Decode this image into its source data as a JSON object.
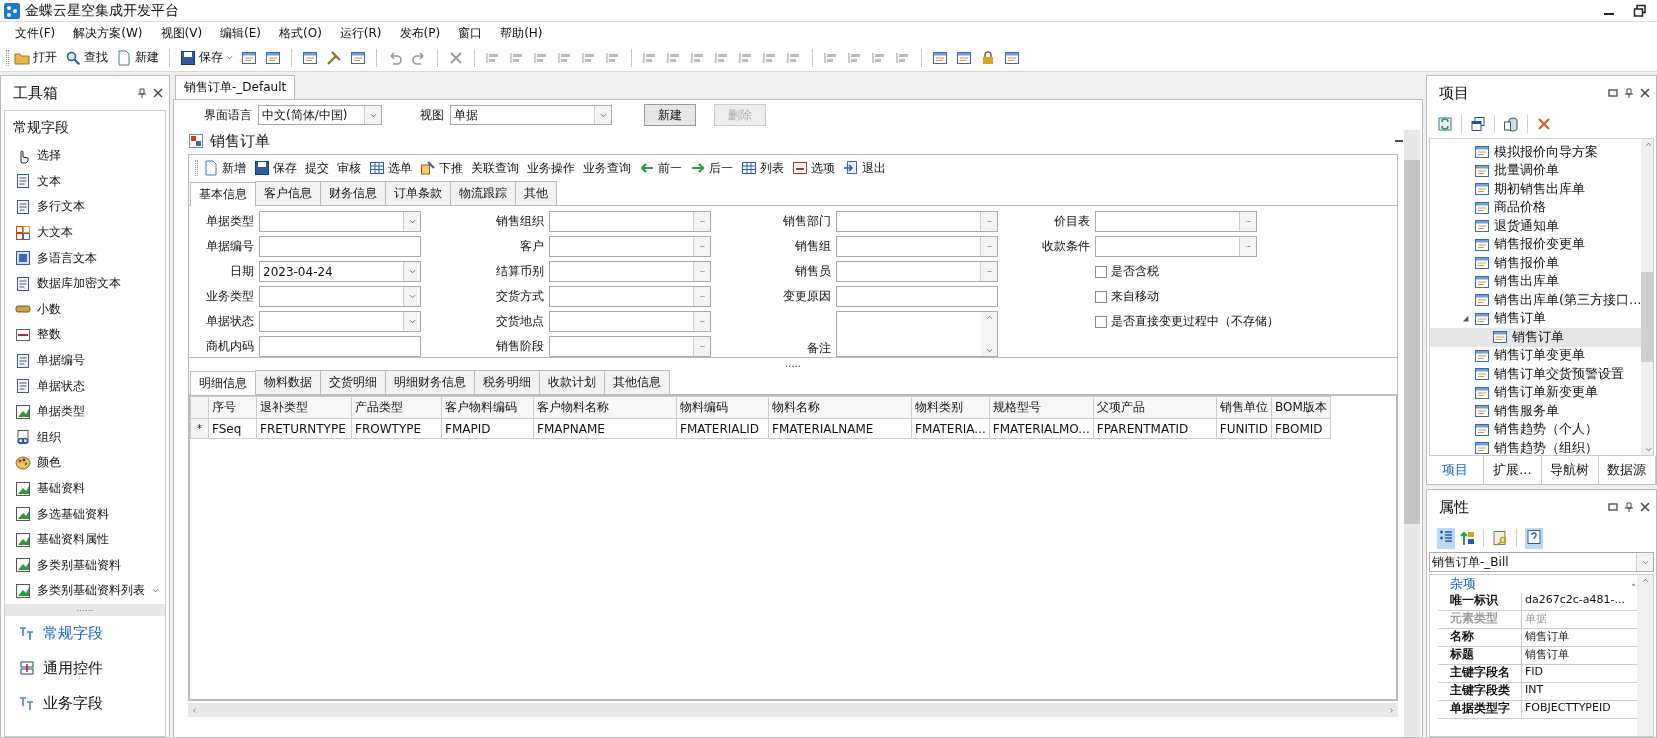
{
  "window": {
    "title": "金蝶云星空集成开发平台"
  },
  "menu": [
    "文件(F)",
    "解决方案(W)",
    "视图(V)",
    "编辑(E)",
    "格式(O)",
    "运行(R)",
    "发布(P)",
    "窗口",
    "帮助(H)"
  ],
  "toolbar": [
    {
      "kind": "button",
      "label": "打开"
    },
    {
      "kind": "button",
      "label": "查找"
    },
    {
      "kind": "button",
      "label": "新建"
    },
    {
      "kind": "separator"
    },
    {
      "kind": "dropdown",
      "label": "保存"
    },
    {
      "kind": "icon"
    },
    {
      "kind": "icon"
    },
    {
      "kind": "separator"
    },
    {
      "kind": "icon"
    },
    {
      "kind": "icon"
    },
    {
      "kind": "icon"
    },
    {
      "kind": "separator"
    },
    {
      "kind": "icon"
    },
    {
      "kind": "icon"
    },
    {
      "kind": "separator"
    },
    {
      "kind": "icon"
    },
    {
      "kind": "separator"
    },
    {
      "kind": "icon"
    },
    {
      "kind": "icon"
    },
    {
      "kind": "icon"
    },
    {
      "kind": "icon"
    },
    {
      "kind": "icon"
    },
    {
      "kind": "icon"
    },
    {
      "kind": "separator"
    },
    {
      "kind": "icon"
    },
    {
      "kind": "icon"
    },
    {
      "kind": "icon"
    },
    {
      "kind": "icon"
    },
    {
      "kind": "icon"
    },
    {
      "kind": "icon"
    },
    {
      "kind": "icon"
    },
    {
      "kind": "separator"
    },
    {
      "kind": "icon"
    },
    {
      "kind": "icon"
    },
    {
      "kind": "icon"
    },
    {
      "kind": "icon"
    },
    {
      "kind": "separator"
    },
    {
      "kind": "icon"
    },
    {
      "kind": "icon"
    },
    {
      "kind": "icon"
    },
    {
      "kind": "icon"
    }
  ],
  "toolbox": {
    "title": "工具箱",
    "category": "常规字段",
    "items": [
      "选择",
      "文本",
      "多行文本",
      "大文本",
      "多语言文本",
      "数据库加密文本",
      "小数",
      "整数",
      "单据编号",
      "单据状态",
      "单据类型",
      "组织",
      "颜色",
      "基础资料",
      "多选基础资料",
      "基础资料属性",
      "多类别基础资料",
      "多类别基础资料列表"
    ],
    "splitter": "......",
    "groups": [
      {
        "label": "常规字段",
        "selected": true
      },
      {
        "label": "通用控件",
        "selected": false
      },
      {
        "label": "业务字段",
        "selected": false
      }
    ]
  },
  "document": {
    "tab": "销售订单-_Default",
    "language": {
      "label": "界面语言",
      "value": "中文(简体/中国)"
    },
    "view": {
      "label": "视图",
      "value": "单据"
    },
    "buttons": [
      {
        "label": "新建",
        "disabled": false
      },
      {
        "label": "删除",
        "disabled": true
      }
    ],
    "form": {
      "title": "销售订单",
      "toolbar": [
        "新增",
        "保存",
        "提交",
        "审核",
        "选单",
        "下推",
        "关联查询",
        "业务操作",
        "业务查询",
        "前一",
        "后一",
        "列表",
        "选项",
        "退出"
      ],
      "tabs": [
        {
          "label": "基本信息",
          "selected": true
        },
        {
          "label": "客户信息",
          "selected": false
        },
        {
          "label": "财务信息",
          "selected": false
        },
        {
          "label": "订单条款",
          "selected": false
        },
        {
          "label": "物流跟踪",
          "selected": false
        },
        {
          "label": "其他",
          "selected": false
        }
      ],
      "columns": [
        [
          {
            "kind": "combo",
            "label": "单据类型"
          },
          {
            "kind": "text",
            "label": "单据编号"
          },
          {
            "kind": "combo",
            "label": "日期",
            "value": "2023-04-24"
          },
          {
            "kind": "combo",
            "label": "业务类型"
          },
          {
            "kind": "combo",
            "label": "单据状态"
          },
          {
            "kind": "text",
            "label": "商机内码"
          }
        ],
        [
          {
            "kind": "lookup",
            "label": "销售组织"
          },
          {
            "kind": "lookup",
            "label": "客户"
          },
          {
            "kind": "lookup",
            "label": "结算币别"
          },
          {
            "kind": "lookup",
            "label": "交货方式"
          },
          {
            "kind": "lookup",
            "label": "交货地点"
          },
          {
            "kind": "lookup",
            "label": "销售阶段"
          }
        ],
        [
          {
            "kind": "lookup",
            "label": "销售部门"
          },
          {
            "kind": "lookup",
            "label": "销售组"
          },
          {
            "kind": "lookup",
            "label": "销售员"
          },
          {
            "kind": "text",
            "label": "变更原因"
          },
          {
            "kind": "memo",
            "label": "备注"
          }
        ],
        [
          {
            "kind": "lookup",
            "label": "价目表"
          },
          {
            "kind": "lookup",
            "label": "收款条件"
          },
          {
            "kind": "checkbox",
            "label": "是否含税",
            "checked": false
          },
          {
            "kind": "checkbox",
            "label": "来自移动",
            "checked": false
          },
          {
            "kind": "checkbox",
            "label": "是否直接变更过程中（不存储）",
            "checked": false
          }
        ]
      ],
      "splitter": ".....",
      "detail_tabs": [
        {
          "label": "明细信息",
          "selected": true
        },
        {
          "label": "物料数据",
          "selected": false
        },
        {
          "label": "交货明细",
          "selected": false
        },
        {
          "label": "明细财务信息",
          "selected": false
        },
        {
          "label": "税务明细",
          "selected": false
        },
        {
          "label": "收款计划",
          "selected": false
        },
        {
          "label": "其他信息",
          "selected": false
        }
      ],
      "table": {
        "row_marker": "*",
        "columns": [
          "序号",
          "退补类型",
          "产品类型",
          "客户物料编码",
          "客户物料名称",
          "物料编码",
          "物料名称",
          "物料类别",
          "规格型号",
          "父项产品",
          "销售单位",
          "BOM版本"
        ],
        "rows": [
          [
            "FSeq",
            "FRETURNTYPE",
            "FROWTYPE",
            "FMAPID",
            "FMAPNAME",
            "FMATERIALID",
            "FMATERIALNAME",
            "FMATERIA...",
            "FMATERIALMO...",
            "FPARENTMATID",
            "FUNITID",
            "FBOMID"
          ]
        ]
      }
    }
  },
  "project": {
    "title": "项目",
    "tree": [
      {
        "label": "模拟报价向导方案",
        "selected": false
      },
      {
        "label": "批量调价单",
        "selected": false
      },
      {
        "label": "期初销售出库单",
        "selected": false
      },
      {
        "label": "商品价格",
        "selected": false
      },
      {
        "label": "退货通知单",
        "selected": false
      },
      {
        "label": "销售报价变更单",
        "selected": false
      },
      {
        "label": "销售报价单",
        "selected": false
      },
      {
        "label": "销售出库单",
        "selected": false
      },
      {
        "label": "销售出库单(第三方接口…",
        "selected": false
      },
      {
        "label": "销售订单",
        "selected": false,
        "expanded": true,
        "children": [
          {
            "label": "销售订单",
            "selected": true
          }
        ]
      },
      {
        "label": "销售订单变更单",
        "selected": false
      },
      {
        "label": "销售订单交货预警设置",
        "selected": false
      },
      {
        "label": "销售订单新变更单",
        "selected": false
      },
      {
        "label": "销售服务单",
        "selected": false
      },
      {
        "label": "销售趋势（个人）",
        "selected": false
      },
      {
        "label": "销售趋势（组织）",
        "selected": false
      }
    ],
    "tabs": [
      {
        "label": "项目",
        "selected": true
      },
      {
        "label": "扩展...",
        "selected": false
      },
      {
        "label": "导航树",
        "selected": false
      },
      {
        "label": "数据源",
        "selected": false
      }
    ]
  },
  "properties": {
    "title": "属性",
    "object": "销售订单-_Bill",
    "category": "杂项",
    "rows": [
      {
        "name": "唯一标识",
        "value": "da267c2c-a481-...",
        "disabled": false
      },
      {
        "name": "元素类型",
        "value": "单据",
        "disabled": true
      },
      {
        "name": "名称",
        "value": "销售订单",
        "disabled": false
      },
      {
        "name": "标题",
        "value": "销售订单",
        "disabled": false
      },
      {
        "name": "主键字段名",
        "value": "FID",
        "disabled": false
      },
      {
        "name": "主键字段类",
        "value": "INT",
        "disabled": false
      },
      {
        "name": "单据类型字",
        "value": "FOBJECTTYPEID",
        "disabled": false
      }
    ]
  }
}
